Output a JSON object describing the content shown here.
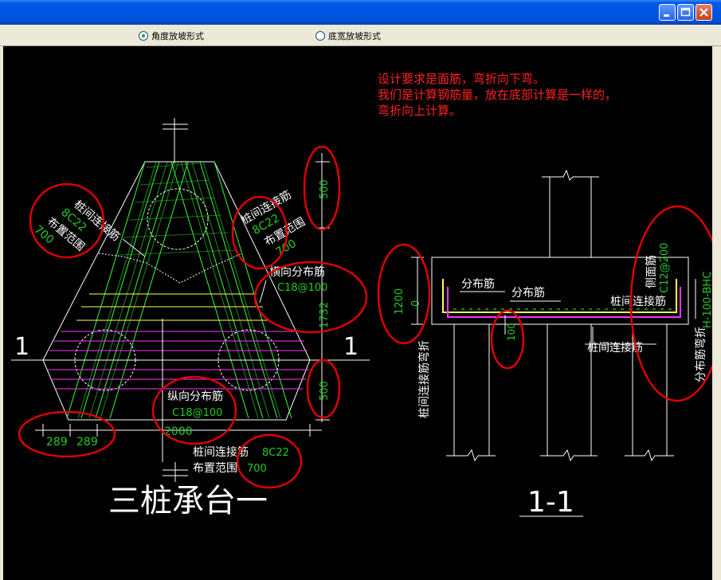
{
  "window": {
    "buttons": [
      "minimize",
      "maximize",
      "close"
    ]
  },
  "options": {
    "angle_label": "角度放坡形式",
    "width_label": "底宽放坡形式",
    "selected": "angle"
  },
  "note": {
    "line1": "设计要求是面筋，弯折向下弯。",
    "line2": "我们是计算钢筋量，放在底部计算是一样的，",
    "line3": "弯折向上计算。"
  },
  "plan": {
    "title": "三桩承台一",
    "section_mark": "1",
    "left_conn_label": "桩间连接筋",
    "left_conn_spec": "8C22",
    "left_range_label": "布置范围",
    "left_range_value": "700",
    "right_conn_label": "桩间连接筋",
    "right_conn_spec": "8C22",
    "right_range_label": "布置范围",
    "right_range_value": "700",
    "trans_dist_label": "横向分布筋",
    "trans_dist_spec": "C18@100",
    "long_dist_label": "纵向分布筋",
    "long_dist_spec": "C18@100",
    "bottom_conn_label": "桩间连接筋",
    "bottom_conn_spec": "8C22",
    "bottom_range_label": "布置范围",
    "bottom_range_value": "700",
    "dim_top": "500",
    "dim_mid": "1732",
    "dim_bot": "500",
    "dim_width": "2000",
    "dim_left1": "289",
    "dim_left2": "289"
  },
  "section": {
    "title": "1-1",
    "dist_label_left": "分布筋",
    "dist_label_mid": "分布筋",
    "conn_label_right": "桩间连接筋",
    "conn_label_bottom": "桩间连接筋",
    "left_vert_label": "桩间连接筋弯折",
    "side_label": "侧面筋",
    "side_spec": "C12@200",
    "side_code": "H-100-BHC",
    "right_vert_label": "分布筋弯折",
    "dim_height": "1200",
    "dim_zero": "0",
    "dim_100": "100"
  },
  "colors": {
    "note": "#ff2020",
    "dim": "#22cc22",
    "rebar_green": "#33ff33",
    "yellow": "#ffff55",
    "magenta": "#ff33ff",
    "annotation": "#dd0000"
  }
}
